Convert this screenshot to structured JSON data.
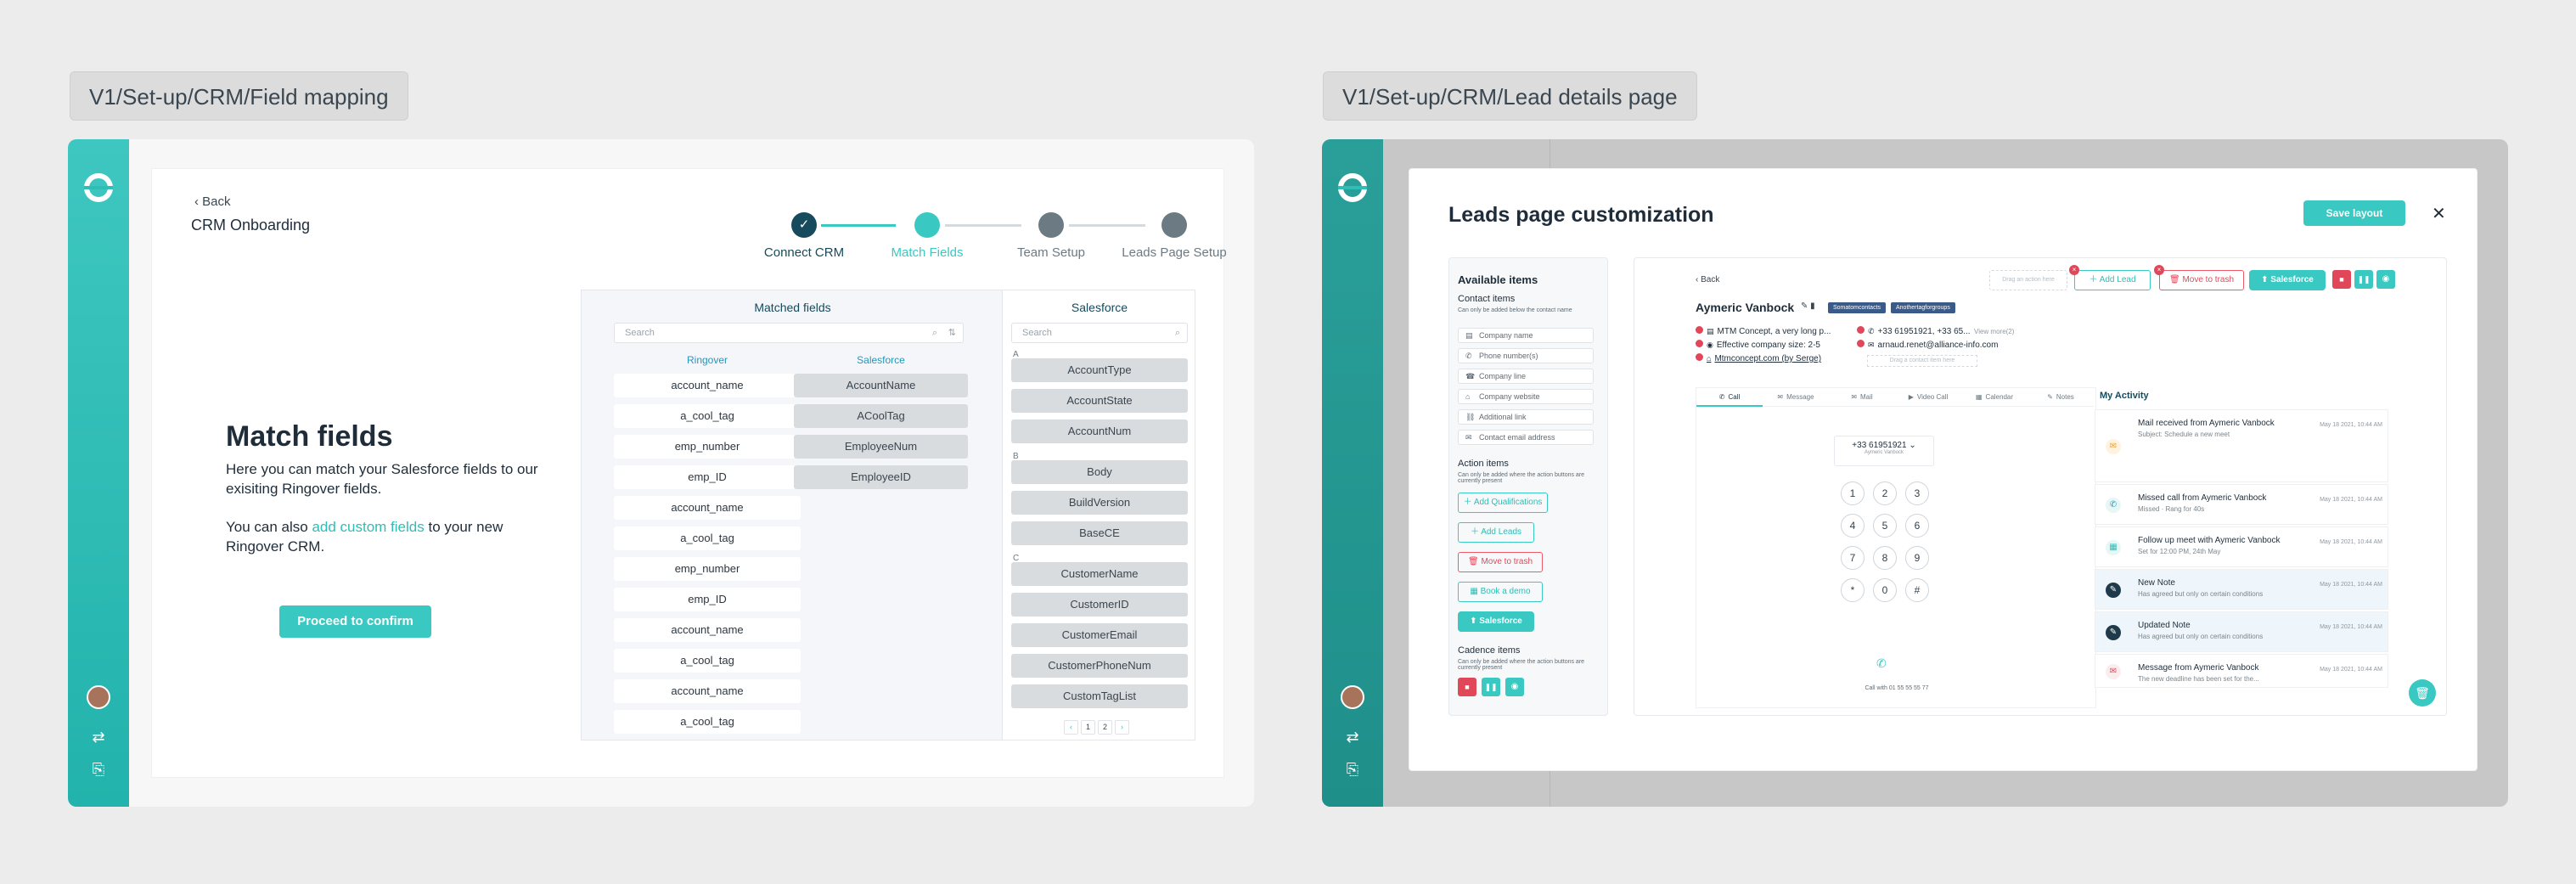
{
  "frames": {
    "left_label": "V1/Set-up/CRM/Field mapping",
    "right_label": "V1/Set-up/CRM/Lead details page"
  },
  "field_mapping": {
    "back": "Back",
    "title": "CRM Onboarding",
    "steps": [
      {
        "label": "Connect CRM",
        "state": "done"
      },
      {
        "label": "Match Fields",
        "state": "active"
      },
      {
        "label": "Team Setup",
        "state": "pending"
      },
      {
        "label": "Leads Page Setup",
        "state": "pending"
      }
    ],
    "heading": "Match fields",
    "desc1": "Here you can match your Salesforce fields to our exisiting Ringover fields.",
    "desc2_pre": "You can also ",
    "desc2_link": "add custom fields",
    "desc2_post": " to your new Ringover CRM.",
    "proceed": "Proceed to confirm",
    "matched_title": "Matched fields",
    "search_placeholder": "Search",
    "col_ringover": "Ringover",
    "col_salesforce": "Salesforce",
    "ringover_fields": [
      "account_name",
      "a_cool_tag",
      "emp_number",
      "emp_ID",
      "account_name",
      "a_cool_tag",
      "emp_number",
      "emp_ID",
      "account_name",
      "a_cool_tag",
      "account_name",
      "a_cool_tag"
    ],
    "matched_salesforce": [
      "AccountName",
      "ACoolTag",
      "EmployeeNum",
      "EmployeeID"
    ],
    "salesforce_title": "Salesforce",
    "sf_groups": [
      {
        "letter": "A",
        "items": [
          "AccountType",
          "AccountState",
          "AccountNum"
        ]
      },
      {
        "letter": "B",
        "items": [
          "Body",
          "BuildVersion",
          "BaseCE"
        ]
      },
      {
        "letter": "C",
        "items": [
          "CustomerName",
          "CustomerID",
          "CustomerEmail",
          "CustomerPhoneNum",
          "CustomTagList"
        ]
      }
    ],
    "pagination": [
      "‹",
      "1",
      "2",
      "›"
    ]
  },
  "lead_page": {
    "title": "Leads page customization",
    "save": "Save layout",
    "close": "✕",
    "available_title": "Available items",
    "contact_title": "Contact items",
    "contact_hint": "Can only be added below the contact name",
    "contact_items": [
      "Company name",
      "Phone number(s)",
      "Company line",
      "Company website",
      "Additional link",
      "Contact email address"
    ],
    "action_title": "Action items",
    "action_hint": "Can only be added where the action buttons are currently present",
    "actions": [
      "Add Qualifications",
      "Add Leads",
      "Move to trash",
      "Book a demo",
      "Salesforce"
    ],
    "cadence_title": "Cadence items",
    "cadence_hint": "Can only be added where the action buttons are currently present",
    "preview": {
      "back": "Back",
      "drag_hint": "Drag an action here",
      "add_lead": "Add Lead",
      "move_trash": "Move to trash",
      "salesforce": "Salesforce",
      "name": "Aymeric Vanbock",
      "tags": [
        "Somatomcontacts",
        "Anothertagforgroups"
      ],
      "info_left": [
        "MTM Concept, a very long p...",
        "Effective company size: 2-5",
        "Mtmconcept.com (by Serge)"
      ],
      "info_right": [
        "+33 61951921, +33 65...",
        "arnaud.renet@alliance-info.com"
      ],
      "view_more": "View more(2)",
      "drag_field": "Drag a contact item here",
      "tabs": [
        "Call",
        "Message",
        "Mail",
        "Video Call",
        "Calendar",
        "Notes"
      ],
      "phone": "+33 61951921",
      "phone_sub": "Aymeric Vanbock",
      "keys": [
        "1",
        "2",
        "3",
        "4",
        "5",
        "6",
        "7",
        "8",
        "9",
        "*",
        "0",
        "#"
      ],
      "call_with": "Call with 01 55 55 55 77",
      "activity_title": "My Activity",
      "activities": [
        {
          "title": "Mail received from Aymeric Vanbock",
          "sub": "Subject: Schedule a new meet",
          "time": "May 18 2021, 10:44 AM"
        },
        {
          "title": "Missed call from Aymeric Vanbock",
          "sub": "Missed   ·   Rang for 40s",
          "time": "May 18 2021, 10:44 AM"
        },
        {
          "title": "Follow up meet with Aymeric Vanbock",
          "sub": "Set for 12:00 PM, 24th May",
          "time": "May 18 2021, 10:44 AM"
        },
        {
          "title": "New Note",
          "sub": "Has agreed but only on certain conditions",
          "time": "May 18 2021, 10:44 AM"
        },
        {
          "title": "Updated Note",
          "sub": "Has agreed but only on certain conditions",
          "time": "May 18 2021, 10:44 AM"
        },
        {
          "title": "Message from Aymeric Vanbock",
          "sub": "The new deadline has been set for the...",
          "time": "May 18 2021, 10:44 AM"
        }
      ]
    }
  }
}
